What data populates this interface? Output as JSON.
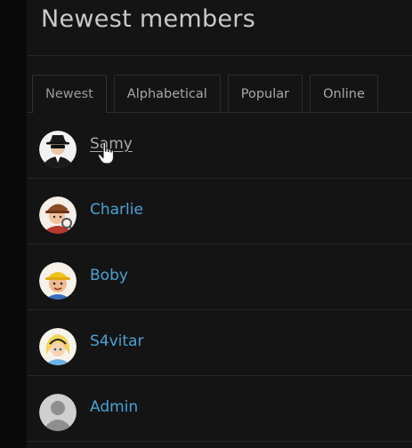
{
  "page": {
    "title": "Newest members"
  },
  "tabs": [
    {
      "label": "Newest",
      "active": true
    },
    {
      "label": "Alphabetical",
      "active": false
    },
    {
      "label": "Popular",
      "active": false
    },
    {
      "label": "Online",
      "active": false
    }
  ],
  "members": [
    {
      "name": "Samy",
      "avatar": "spy-avatar",
      "hovered": true
    },
    {
      "name": "Charlie",
      "avatar": "detective-avatar",
      "hovered": false
    },
    {
      "name": "Boby",
      "avatar": "builder-avatar",
      "hovered": false
    },
    {
      "name": "S4vitar",
      "avatar": "alice-avatar",
      "hovered": false
    },
    {
      "name": "Admin",
      "avatar": "default-user-avatar",
      "hovered": false
    }
  ],
  "colors": {
    "link": "#4aa2d6",
    "background": "#141414",
    "border": "#2c2c2c"
  }
}
